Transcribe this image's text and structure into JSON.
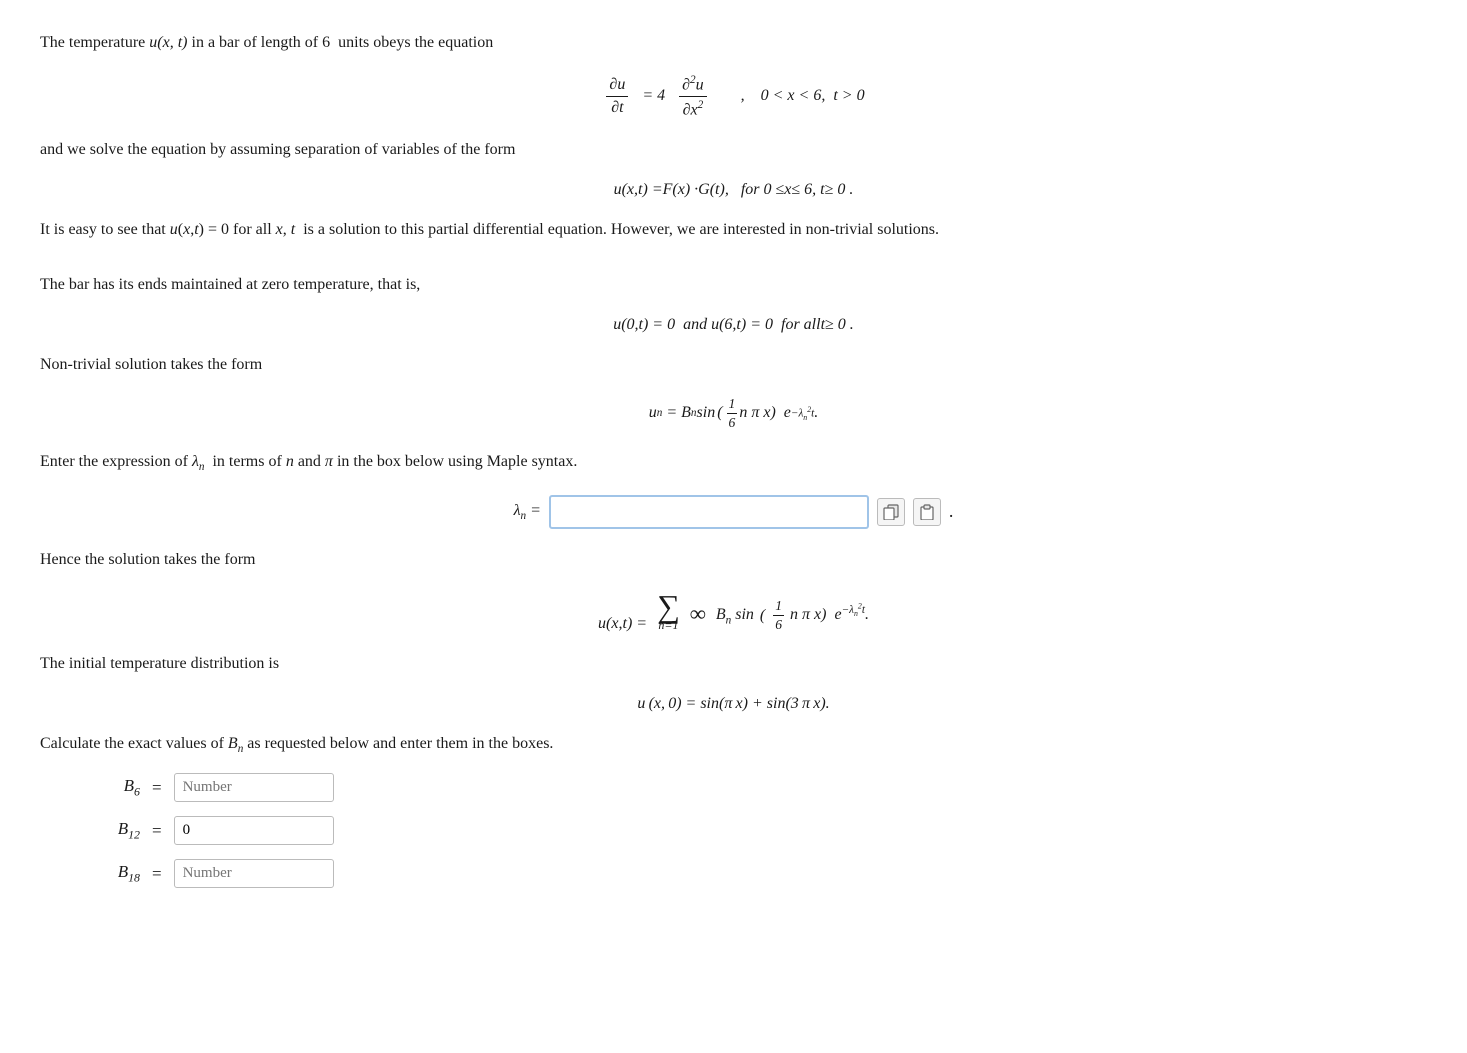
{
  "intro_text": "The temperature",
  "u_xt": "u(x, t)",
  "bar_length": "in a bar of length of 6  units obeys the equation",
  "pde_label": "∂u/∂t = 4 ∂²u/∂x², 0 < x < 6, t > 0",
  "separation_text": "and we solve the equation by assuming separation of variables of the form",
  "separation_form": "u(x,t) = F(x) · G(t),  for 0 ≤ x ≤ 6,  t ≥ 0 .",
  "trivial_text1": "It is easy to see that",
  "trivial_eq": "u(x,t) = 0",
  "trivial_text2": "for all",
  "trivial_vars": "x, t",
  "trivial_text3": "is a solution to this partial differential equation. However, we are interested in non-trivial solutions.",
  "bc_intro": "The bar has its ends maintained at zero temperature, that is,",
  "bc_eq": "u(0,t) = 0 and  u(6,t) = 0  for all t ≥ 0 .",
  "nontrivial_intro": "Non-trivial solution takes the form",
  "nontrivial_eq_label": "u_n = B_n sin(1/6 n π x) e^{-λ_n² t}",
  "lambda_prompt": "Enter the expression of λ_n  in terms of n and π in the box below using Maple syntax.",
  "lambda_label": "λn =",
  "lambda_input_placeholder": "",
  "lambda_input_value": "",
  "copy_icon": "📋",
  "paste_icon": "📄",
  "hence_text": "Hence the solution takes the form",
  "solution_eq": "u(x,t) = Σ B_n sin(1/6 n π x) e^{-λ_n² t}",
  "initial_intro": "The initial temperature distribution is",
  "initial_eq": "u(x, 0) = sin(π x) + sin(3 π x).",
  "calculate_text": "Calculate the exact values of B_n as requested below and enter them in the boxes.",
  "bn_rows": [
    {
      "subscript": "6",
      "label": "B₆ =",
      "value": "",
      "placeholder": "Number"
    },
    {
      "subscript": "12",
      "label": "B₁₂ =",
      "value": "0",
      "placeholder": ""
    },
    {
      "subscript": "18",
      "label": "B₁₈ =",
      "value": "",
      "placeholder": "Number"
    }
  ]
}
